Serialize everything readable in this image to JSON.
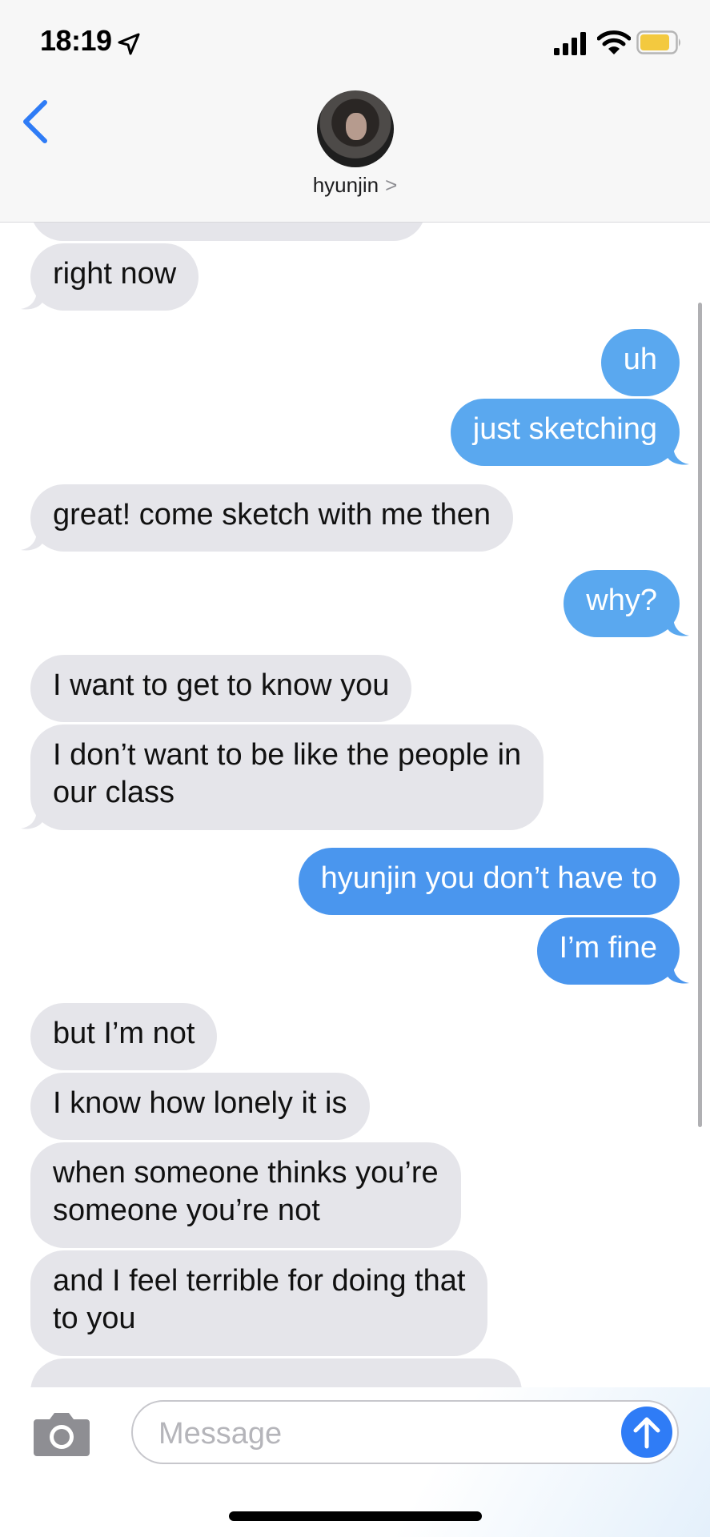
{
  "status_bar": {
    "time": "18:19"
  },
  "header": {
    "contact_name": "hyunjin",
    "chevron": ">"
  },
  "messages": [
    {
      "from": "them",
      "text": "right now"
    },
    {
      "from": "me",
      "text": "uh"
    },
    {
      "from": "me",
      "text": "just sketching"
    },
    {
      "from": "them",
      "text": "great! come sketch with me then"
    },
    {
      "from": "me",
      "text": "why?"
    },
    {
      "from": "them",
      "text": "I want to get to know you"
    },
    {
      "from": "them",
      "line1": "I don’t want to be like the people in",
      "line2": "our class"
    },
    {
      "from": "me",
      "text": "hyunjin you don’t have to"
    },
    {
      "from": "me",
      "text": "I’m fine"
    },
    {
      "from": "them",
      "text": "but I’m not"
    },
    {
      "from": "them",
      "text": "I know how lonely it is"
    },
    {
      "from": "them",
      "line1": "when someone thinks you’re",
      "line2": "someone you’re not"
    },
    {
      "from": "them",
      "line1": "and I feel terrible for doing that",
      "line2": "to you"
    }
  ],
  "composer": {
    "placeholder": "Message"
  },
  "colors": {
    "incoming": "#e5e5ea",
    "outgoing": "#5aa8ef",
    "accent": "#2f7cf6"
  },
  "icons": [
    "location-arrow-icon",
    "signal-icon",
    "wifi-icon",
    "battery-icon",
    "back-chevron-icon",
    "camera-icon",
    "send-arrow-icon"
  ]
}
